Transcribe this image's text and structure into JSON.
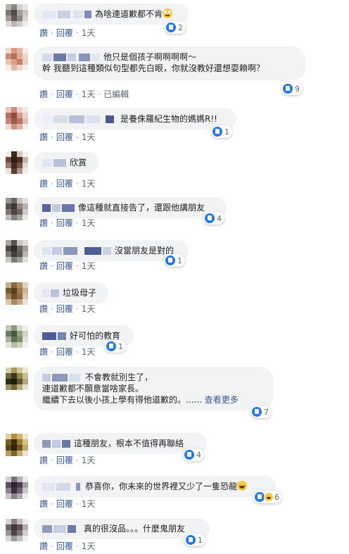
{
  "actions": {
    "like": "讚",
    "reply": "回覆",
    "edited": "已編輯"
  },
  "comments": [
    {
      "text": "為啥連道歉都不肯",
      "text_line2": "",
      "more": "",
      "emoji": "face-with-rolling-eyes",
      "reaction_count": "2",
      "time": "1天",
      "edited": false
    },
    {
      "text": "他只是個孩子啊啊啊啊～",
      "text_line2": "幹 我聽到這種類似句型都先白眼，你就沒教好還想耍賴啊？",
      "more": "",
      "emoji": "",
      "reaction_count": "9",
      "time": "1天",
      "edited": true
    },
    {
      "text": "是養侏羅紀生物的媽媽R!!",
      "text_line2": "",
      "more": "",
      "emoji": "",
      "reaction_count": "1",
      "time": "1天",
      "edited": false
    },
    {
      "text": "欣賞",
      "text_line2": "",
      "more": "",
      "emoji": "",
      "reaction_count": "",
      "time": "1天",
      "edited": false
    },
    {
      "text": "像這種就直接告了，還跟他講朋友",
      "text_line2": "",
      "more": "",
      "emoji": "",
      "reaction_count": "4",
      "time": "1天",
      "edited": false
    },
    {
      "text": "沒當朋友是對的",
      "text_line2": "",
      "more": "",
      "emoji": "",
      "reaction_count": "1",
      "time": "1天",
      "edited": false
    },
    {
      "text": "垃圾母子",
      "text_line2": "",
      "more": "",
      "emoji": "",
      "reaction_count": "",
      "time": "1天",
      "edited": false
    },
    {
      "text": "好可怕的教育",
      "text_line2": "",
      "more": "",
      "emoji": "",
      "reaction_count": "1",
      "time": "1天",
      "edited": false
    },
    {
      "text": "不會教就別生了，",
      "text_line2": "連道歉都不願意當啥家長。",
      "text_line3": "繼續下去以後小孩上學有得他道歉的。......",
      "more": "查看更多",
      "emoji": "",
      "reaction_count": "7",
      "time": "1天",
      "edited": false
    },
    {
      "text": "這種朋友，根本不值得再聯絡",
      "text_line2": "",
      "more": "",
      "emoji": "",
      "reaction_count": "4",
      "time": "1天",
      "edited": false
    },
    {
      "text": "恭喜你，你未來的世界裡又少了一隻恐龍",
      "text_line2": "",
      "more": "",
      "emoji": "grinning-face-with-sweat",
      "reaction_count": "6",
      "time": "1天",
      "edited": false
    },
    {
      "text": "真的很沒品。。。什麼鬼朋友",
      "text_line2": "",
      "more": "",
      "emoji": "",
      "reaction_count": "1",
      "time": "1天",
      "edited": false
    }
  ],
  "colors": {
    "bubble": "#f2f3f5",
    "link": "#385898",
    "like_blue": "#2078f4",
    "meta_gray": "#606770"
  }
}
